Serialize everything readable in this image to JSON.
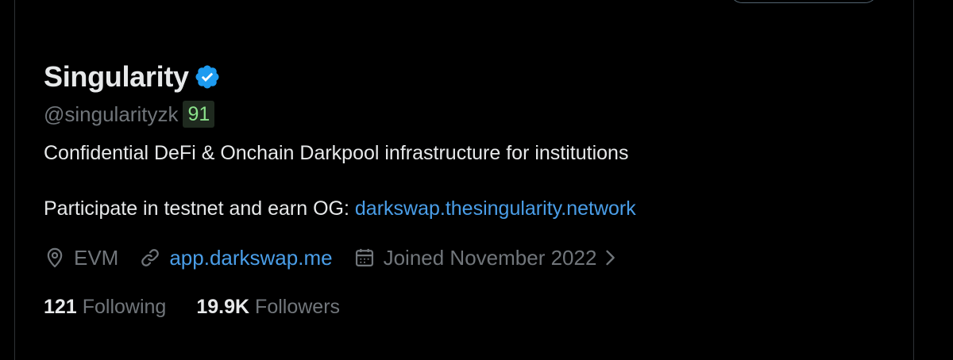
{
  "profile": {
    "display_name": "Singularity",
    "handle": "@singularityzk",
    "score": "91",
    "bio": "Confidential DeFi & Onchain Darkpool infrastructure for institutions",
    "bio_line2_prefix": "Participate in testnet and earn OG: ",
    "bio_line2_link": "darkswap.thesingularity.network",
    "location": "EVM",
    "website": "app.darkswap.me",
    "joined": "Joined November 2022"
  },
  "stats": {
    "following_count": "121",
    "following_label": "Following",
    "followers_count": "19.9K",
    "followers_label": "Followers"
  },
  "colors": {
    "background": "#000000",
    "text": "#e7e9ea",
    "muted": "#71767b",
    "link": "#4a9ee8",
    "verified": "#1d9bf0",
    "score_text": "#8be28b"
  },
  "icons": {
    "verified": "verified-badge-icon",
    "location": "location-pin-icon",
    "website": "link-icon",
    "joined": "calendar-icon",
    "more": "chevron-right-icon"
  }
}
